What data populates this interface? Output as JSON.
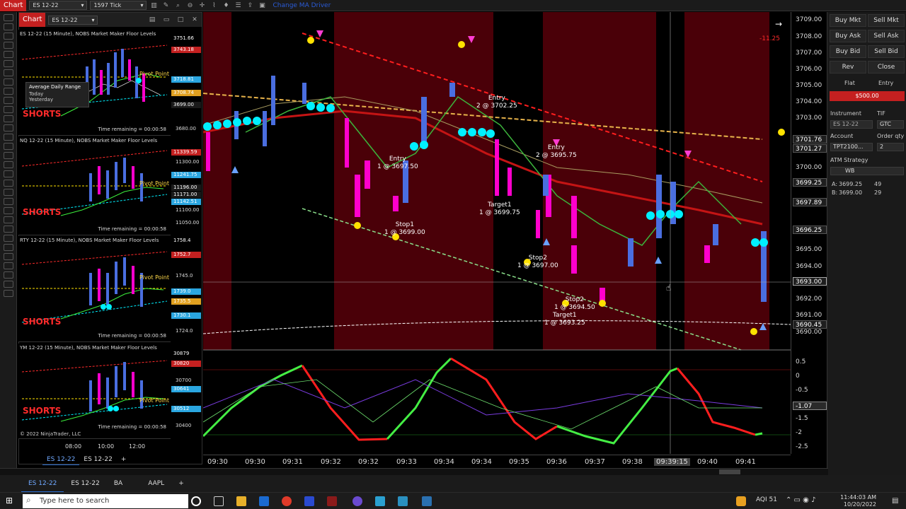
{
  "topbar": {
    "chart_tab": "Chart",
    "instrument": "ES 12-22",
    "interval": "1597 Tick",
    "ma_driver": "Change MA Driver"
  },
  "mini_panel": {
    "tab_label": "Chart",
    "instrument": "ES 12-22",
    "charts": [
      {
        "title": "ES 12-22 (15 Minute), NOBS Market Maker Floor Levels",
        "pivot": "Pivot Point",
        "shorts": "SHORTS",
        "time_remaining": "Time remaining = 00:00:58",
        "overlay_title": "Average Daily Range",
        "overlay_rows": [
          "Today",
          "Yesterday"
        ],
        "tags": [
          "3751.66",
          "3743.18",
          "3718.81",
          "3708.74",
          "3699.00"
        ],
        "ticks": [
          "3680.00"
        ]
      },
      {
        "title": "NQ 12-22 (15 Minute), NOBS Market Maker Floor Levels",
        "pivot": "Pivot Point",
        "shorts": "SHORTS",
        "time_remaining": "Time remaining = 00:00:58",
        "tags": [
          "11339.59",
          "11241.75",
          "11196.00",
          "11171.00",
          "11142.51"
        ],
        "ticks": [
          "11300.00",
          "11100.00",
          "11050.00"
        ]
      },
      {
        "title": "RTY 12-22 (15 Minute), NOBS Market Maker Floor Levels",
        "pivot": "Pivot Point",
        "shorts": "SHORTS",
        "time_remaining": "Time remaining = 00:00:58",
        "tags": [
          "1758.4",
          "1752.7",
          "1739.0",
          "1735.5",
          "1730.1"
        ],
        "ticks": [
          "1745.0",
          "1724.0"
        ]
      },
      {
        "title": "YM 12-22 (15 Minute), NOBS Market Maker Floor Levels",
        "pivot": "Pivot Point",
        "shorts": "SHORTS",
        "time_remaining": "Time remaining = 00:00:58",
        "copyright": "© 2022 NinjaTrader, LLC",
        "tags": [
          "30879",
          "30820",
          "30641",
          "30512"
        ],
        "ticks": [
          "30700",
          "30400"
        ],
        "time_ticks": [
          "08:00",
          "10:00",
          "12:00"
        ]
      }
    ],
    "chart_tabs": [
      "ES 12-22",
      "ES 12-22"
    ],
    "add_tab": "+"
  },
  "main_chart": {
    "price_labels": [
      "3709.00",
      "3708.00",
      "3707.00",
      "3706.00",
      "3705.00",
      "3704.00",
      "3703.00",
      "3700.00",
      "3695.00",
      "3694.00",
      "3692.00",
      "3691.00",
      "3690.00"
    ],
    "price_tags": [
      {
        "text": "3701.76",
        "color": "#1e1e1e"
      },
      {
        "text": "3701.27",
        "color": "#1e1e1e"
      },
      {
        "text": "3699.25",
        "color": "#1e1e1e"
      },
      {
        "text": "3697.89",
        "color": "#1e1e1e"
      },
      {
        "text": "3696.25",
        "color": "#1e1e1e"
      },
      {
        "text": "3693.00",
        "color": "#1e1e1e"
      },
      {
        "text": "3690.45",
        "color": "#1e1e1e"
      }
    ],
    "pnl": "-11.25",
    "osc_labels": [
      "0.5",
      "0",
      "-0.5",
      "-1.5",
      "-2",
      "-2.5"
    ],
    "osc_tag": "-1.07",
    "time_labels": [
      "09:30",
      "09:30",
      "09:31",
      "09:32",
      "09:32",
      "09:33",
      "09:34",
      "09:34",
      "09:35",
      "09:36",
      "09:37",
      "09:38",
      "09:40",
      "09:41"
    ],
    "cursor_time": "09:39:15",
    "annotations": [
      {
        "id": "entry-1",
        "lines": [
          "Entry",
          "1 @ 3697.50"
        ]
      },
      {
        "id": "stop1",
        "lines": [
          "Stop1",
          "1 @ 3699.00"
        ]
      },
      {
        "id": "entry-2",
        "lines": [
          "Entry",
          "2 @ 3702.25"
        ]
      },
      {
        "id": "target1-a",
        "lines": [
          "Target1",
          "1 @ 3699.75"
        ]
      },
      {
        "id": "entry-3",
        "lines": [
          "Entry",
          "2 @ 3695.75"
        ]
      },
      {
        "id": "stop2-a",
        "lines": [
          "Stop2",
          "1 @ 3697.00"
        ]
      },
      {
        "id": "stop2-b",
        "lines": [
          "Stop2",
          "1 @ 3694.50"
        ]
      },
      {
        "id": "target1-b",
        "lines": [
          "Target1",
          "1 @ 3693.25"
        ]
      }
    ]
  },
  "order_panel": {
    "buy_mkt": "Buy Mkt",
    "sell_mkt": "Sell Mkt",
    "buy_ask": "Buy Ask",
    "sell_ask": "Sell Ask",
    "buy_bid": "Buy Bid",
    "sell_bid": "Sell Bid",
    "rev": "Rev",
    "close": "Close",
    "flat": "Flat",
    "entry": "Entry",
    "pnl": "$500.00",
    "instrument_label": "Instrument",
    "tif_label": "TIF",
    "instrument_value": "ES 12-22",
    "tif_value": "GTC",
    "account_label": "Account",
    "order_qty_label": "Order qty",
    "account_value": "TPT2100...",
    "order_qty_value": "2",
    "atm_label": "ATM Strategy",
    "atm_value": "WB",
    "ask_label": "A:",
    "ask_price": "3699.25",
    "ask_size": "49",
    "bid_label": "B:",
    "bid_price": "3699.00",
    "bid_size": "29"
  },
  "workspace_tabs": [
    "ES 12-22",
    "ES 12-22",
    "BA",
    "AAPL"
  ],
  "workspace_add": "+",
  "taskbar": {
    "search_placeholder": "Type here to search",
    "aqi": "AQI 51",
    "time": "11:44:03 AM",
    "date": "10/20/2022"
  },
  "colors": {
    "accent_red": "#c42020",
    "bg_red": "#4a0008",
    "up_bar": "#4a6ee0",
    "down_bar": "#ff00cc",
    "cyan": "#00f0ff",
    "yellow": "#ffe200",
    "osc_green": "#44ee44",
    "osc_red": "#ff1e1e"
  }
}
